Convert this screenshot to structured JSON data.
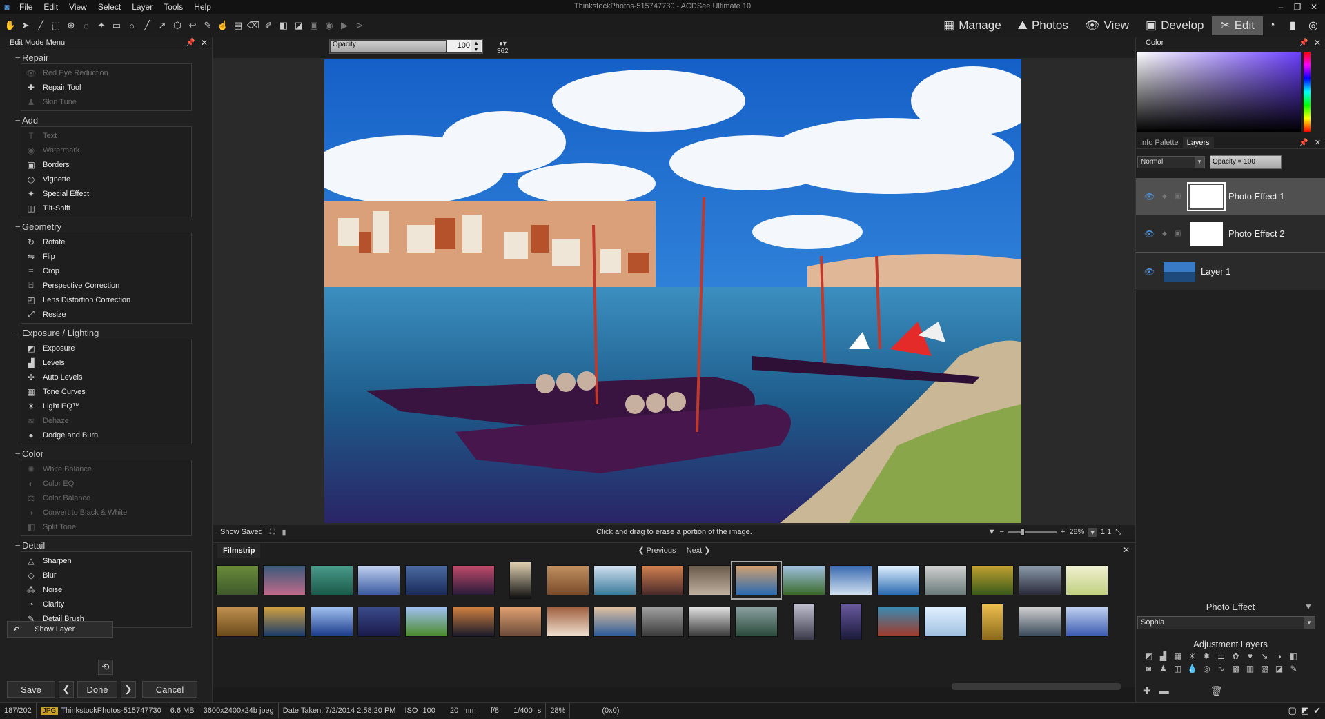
{
  "window": {
    "title": "ThinkstockPhotos-515747730 - ACDSee Ultimate 10"
  },
  "menu": [
    "File",
    "Edit",
    "View",
    "Select",
    "Layer",
    "Tools",
    "Help"
  ],
  "modes": [
    {
      "label": "Manage",
      "icon": "grid-icon"
    },
    {
      "label": "Photos",
      "icon": "photos-icon"
    },
    {
      "label": "View",
      "icon": "eye-icon"
    },
    {
      "label": "Develop",
      "icon": "develop-icon"
    },
    {
      "label": "Edit",
      "icon": "edit-icon",
      "active": true
    }
  ],
  "left_panel": {
    "title": "Edit Mode Menu",
    "sections": [
      {
        "title": "Repair",
        "items": [
          {
            "label": "Red Eye Reduction",
            "enabled": false,
            "icon": "eye-icon"
          },
          {
            "label": "Repair Tool",
            "enabled": true,
            "icon": "bandage-icon"
          },
          {
            "label": "Skin Tune",
            "enabled": false,
            "icon": "person-icon"
          }
        ]
      },
      {
        "title": "Add",
        "items": [
          {
            "label": "Text",
            "enabled": false,
            "icon": "text-icon"
          },
          {
            "label": "Watermark",
            "enabled": false,
            "icon": "watermark-icon"
          },
          {
            "label": "Borders",
            "enabled": true,
            "icon": "borders-icon"
          },
          {
            "label": "Vignette",
            "enabled": true,
            "icon": "vignette-icon"
          },
          {
            "label": "Special Effect",
            "enabled": true,
            "icon": "wand-icon"
          },
          {
            "label": "Tilt-Shift",
            "enabled": true,
            "icon": "tilt-shift-icon"
          }
        ]
      },
      {
        "title": "Geometry",
        "items": [
          {
            "label": "Rotate",
            "enabled": true,
            "icon": "rotate-icon"
          },
          {
            "label": "Flip",
            "enabled": true,
            "icon": "flip-icon"
          },
          {
            "label": "Crop",
            "enabled": true,
            "icon": "crop-icon"
          },
          {
            "label": "Perspective Correction",
            "enabled": true,
            "icon": "perspective-icon"
          },
          {
            "label": "Lens Distortion Correction",
            "enabled": true,
            "icon": "lens-icon"
          },
          {
            "label": "Resize",
            "enabled": true,
            "icon": "resize-icon"
          }
        ]
      },
      {
        "title": "Exposure / Lighting",
        "items": [
          {
            "label": "Exposure",
            "enabled": true,
            "icon": "exposure-icon"
          },
          {
            "label": "Levels",
            "enabled": true,
            "icon": "levels-icon"
          },
          {
            "label": "Auto Levels",
            "enabled": true,
            "icon": "auto-levels-icon"
          },
          {
            "label": "Tone Curves",
            "enabled": true,
            "icon": "curves-icon"
          },
          {
            "label": "Light EQ™",
            "enabled": true,
            "icon": "sun-icon"
          },
          {
            "label": "Dehaze",
            "enabled": false,
            "icon": "dehaze-icon"
          },
          {
            "label": "Dodge and Burn",
            "enabled": true,
            "icon": "dodge-icon"
          }
        ]
      },
      {
        "title": "Color",
        "items": [
          {
            "label": "White Balance",
            "enabled": false,
            "icon": "wb-icon"
          },
          {
            "label": "Color EQ",
            "enabled": false,
            "icon": "color-eq-icon"
          },
          {
            "label": "Color Balance",
            "enabled": false,
            "icon": "color-balance-icon"
          },
          {
            "label": "Convert to Black & White",
            "enabled": false,
            "icon": "bw-icon"
          },
          {
            "label": "Split Tone",
            "enabled": false,
            "icon": "split-tone-icon"
          }
        ]
      },
      {
        "title": "Detail",
        "items": [
          {
            "label": "Sharpen",
            "enabled": true,
            "icon": "sharpen-icon"
          },
          {
            "label": "Blur",
            "enabled": true,
            "icon": "blur-icon"
          },
          {
            "label": "Noise",
            "enabled": true,
            "icon": "noise-icon"
          },
          {
            "label": "Clarity",
            "enabled": true,
            "icon": "clarity-icon"
          },
          {
            "label": "Detail Brush",
            "enabled": true,
            "icon": "brush-icon"
          }
        ]
      }
    ],
    "show_layer": "Show Layer",
    "save": "Save",
    "done": "Done",
    "cancel": "Cancel"
  },
  "options": {
    "opacity_label": "Opacity",
    "opacity_value": "100",
    "brush_size": "362"
  },
  "canvas": {
    "show_saved": "Show Saved",
    "hint": "Click and drag to erase a portion of the image.",
    "zoom": "28%",
    "ratio": "1:1"
  },
  "filmstrip": {
    "tab": "Filmstrip",
    "previous": "Previous",
    "next": "Next"
  },
  "right_panel": {
    "color_title": "Color",
    "tabs": [
      "Info Palette",
      "Layers"
    ],
    "blend_mode": "Normal",
    "opacity": "Opacity = 100",
    "layers": [
      {
        "name": "Photo Effect  1",
        "selected": true
      },
      {
        "name": "Photo Effect  2",
        "selected": false
      },
      {
        "name": "Layer 1",
        "selected": false
      }
    ],
    "photo_effect_title": "Photo Effect",
    "preset": "Sophia",
    "adjustment_title": "Adjustment Layers"
  },
  "status": {
    "index": "187/202",
    "format": "JPG",
    "filename": "ThinkstockPhotos-515747730",
    "size": "6.6 MB",
    "dims": "3600x2400x24b jpeg",
    "date": "Date Taken: 7/2/2014 2:58:20 PM",
    "iso": "ISO 100",
    "focal": "20 mm",
    "aperture": "f/8",
    "shutter": "1/400 s",
    "zoom": "28%",
    "coords": "(0x0)"
  }
}
